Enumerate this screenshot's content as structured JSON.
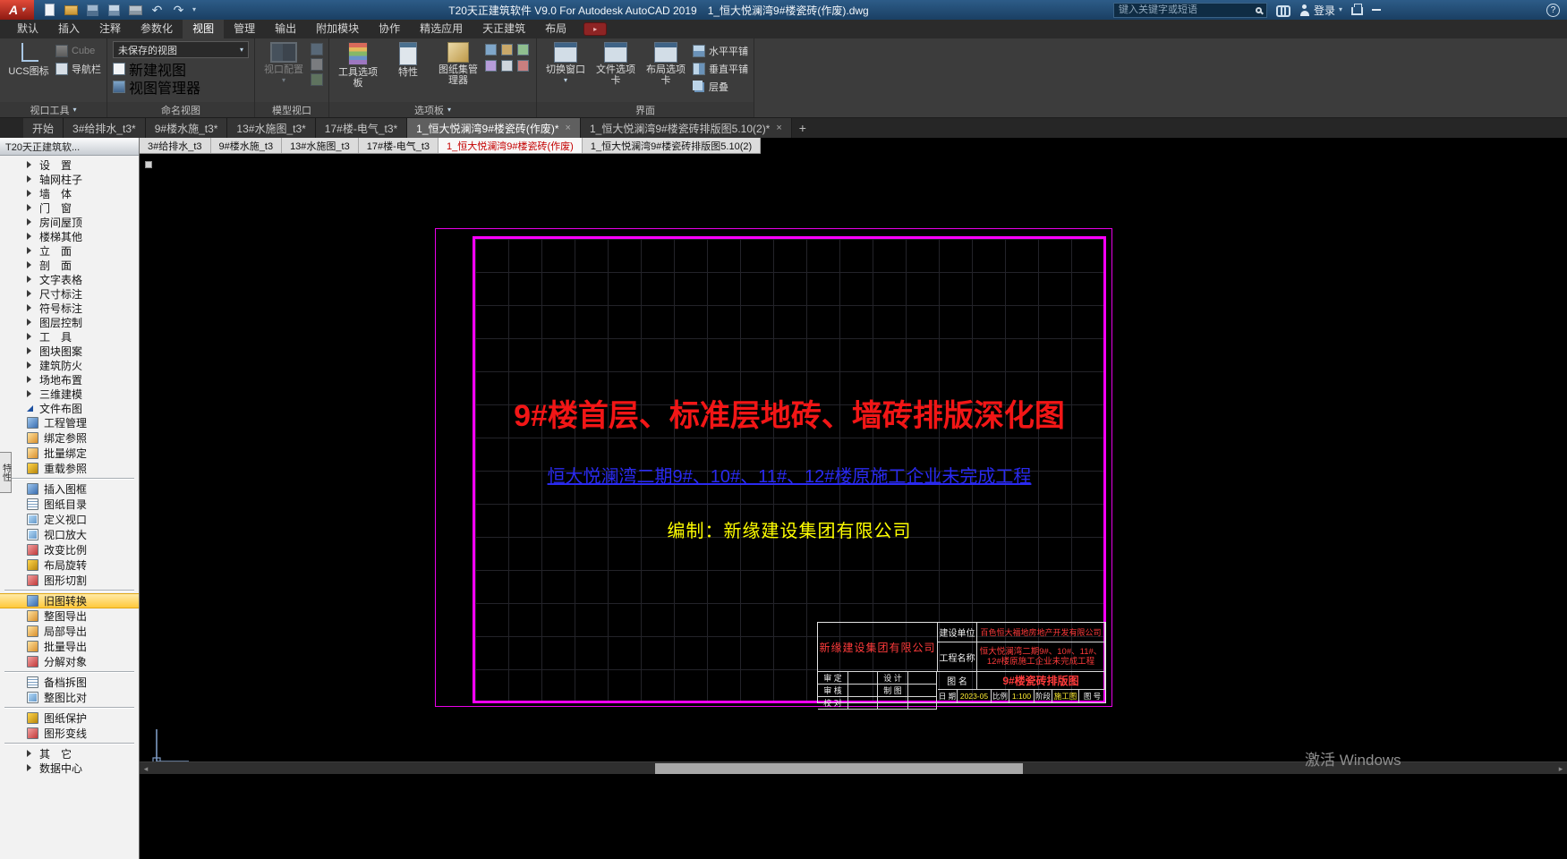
{
  "titlebar": {
    "title": "T20天正建筑软件 V9.0 For Autodesk AutoCAD 2019　1_恒大悦澜湾9#楼瓷砖(作废).dwg",
    "search_placeholder": "键入关键字或短语",
    "login_label": "登录"
  },
  "ribbon": {
    "tabs": [
      "默认",
      "插入",
      "注释",
      "参数化",
      "视图",
      "管理",
      "输出",
      "附加模块",
      "协作",
      "精选应用",
      "天正建筑",
      "布局"
    ],
    "active_tab": "视图",
    "panels": {
      "viewport_tools": {
        "label": "视口工具",
        "ucs_icon": "UCS图标",
        "viewcube": "Cube",
        "navbar": "导航栏"
      },
      "named_views": {
        "label": "命名视图",
        "combo_value": "未保存的视图",
        "new_view": "新建视图",
        "view_manager": "视图管理器"
      },
      "model_viewports": {
        "label": "模型视口",
        "viewport_config": "视口配置"
      },
      "palettes": {
        "label": "选项板",
        "tool_palettes": "工具选项板",
        "properties": "特性",
        "sheet_set": "图纸集管理器"
      },
      "interface": {
        "label": "界面",
        "switch_windows": "切换窗口",
        "file_tabs": "文件选项卡",
        "layout_tabs": "布局选项卡",
        "tile_h": "水平平铺",
        "tile_v": "垂直平铺",
        "cascade": "层叠"
      }
    }
  },
  "file_tabs": {
    "tabs": [
      "开始",
      "3#给排水_t3*",
      "9#楼水施_t3*",
      "13#水施图_t3*",
      "17#楼-电气_t3*",
      "1_恒大悦澜湾9#楼瓷砖(作废)*",
      "1_恒大悦澜湾9#楼瓷砖排版图5.10(2)*"
    ],
    "active_index": 5
  },
  "t20_tabs": {
    "tabs": [
      "3#给排水_t3",
      "9#楼水施_t3",
      "13#水施图_t3",
      "17#楼-电气_t3",
      "1_恒大悦澜湾9#楼瓷砖(作废)",
      "1_恒大悦澜湾9#楼瓷砖排版图5.10(2)"
    ],
    "active_index": 4
  },
  "sidebar": {
    "title": "T20天正建筑软...",
    "properties_tab": "特性",
    "groups": [
      "设　置",
      "轴网柱子",
      "墙　体",
      "门　窗",
      "房间屋顶",
      "楼梯其他",
      "立　面",
      "剖　面",
      "文字表格",
      "尺寸标注",
      "符号标注",
      "图层控制",
      "工　具",
      "图块图案",
      "建筑防火",
      "场地布置",
      "三维建模",
      "文件布图"
    ],
    "items": [
      {
        "label": "工程管理",
        "icon": "project-manager-icon"
      },
      {
        "label": "绑定参照",
        "icon": "bind-xref-icon"
      },
      {
        "label": "批量绑定",
        "icon": "batch-bind-icon"
      },
      {
        "label": "重载参照",
        "icon": "reload-xref-icon"
      },
      {
        "label": "插入图框",
        "icon": "insert-frame-icon"
      },
      {
        "label": "图纸目录",
        "icon": "sheet-catalog-icon"
      },
      {
        "label": "定义视口",
        "icon": "define-viewport-icon"
      },
      {
        "label": "视口放大",
        "icon": "viewport-zoom-icon"
      },
      {
        "label": "改变比例",
        "icon": "change-scale-icon"
      },
      {
        "label": "布局旋转",
        "icon": "layout-rotate-icon"
      },
      {
        "label": "图形切割",
        "icon": "drawing-cut-icon"
      },
      {
        "label": "旧图转换",
        "icon": "old-drawing-convert-icon"
      },
      {
        "label": "整图导出",
        "icon": "export-whole-icon"
      },
      {
        "label": "局部导出",
        "icon": "export-partial-icon"
      },
      {
        "label": "批量导出",
        "icon": "batch-export-icon"
      },
      {
        "label": "分解对象",
        "icon": "explode-object-icon"
      },
      {
        "label": "备档拆图",
        "icon": "archive-split-icon"
      },
      {
        "label": "整图比对",
        "icon": "drawing-compare-icon"
      },
      {
        "label": "图纸保护",
        "icon": "drawing-protect-icon"
      },
      {
        "label": "图形变线",
        "icon": "drawing-to-line-icon"
      }
    ],
    "more": [
      "其　它",
      "数据中心"
    ],
    "highlighted_item": "旧图转换"
  },
  "drawing": {
    "main_title": "9#楼首层、标准层地砖、墙砖排版深化图",
    "subtitle": "恒大悦澜湾二期9#、10#、11#、12#楼原施工企业未完成工程",
    "compiler": "编制：新缘建设集团有限公司",
    "titleblock": {
      "company": "新缘建设集团有限公司",
      "build_unit_label": "建设单位",
      "build_unit_value": "百色恒大福地房地产开发有限公司",
      "project_label": "工程名称",
      "project_value": "恒大悦澜湾二期9#、10#、11#、12#楼原施工企业未完成工程",
      "approver_label": "审 定",
      "designer_label": "设 计",
      "checker_label": "审 核",
      "drafter_label": "制 图",
      "proof_label": "校 对",
      "title_label": "图 名",
      "title_value": "9#楼瓷砖排版图",
      "date_label": "日 期",
      "date_value": "2023-05",
      "scale_label": "比例",
      "scale_value": "1:100",
      "stage_label": "阶段",
      "stage_value": "施工图",
      "no_label": "图 号"
    }
  },
  "watermark": "激活 Windows",
  "colors": {
    "sheet_border_magenta": "#FF00FF",
    "title_red": "#F21616",
    "subtitle_blue": "#2A2AF0",
    "text_yellow": "#FFFF00",
    "highlight_yellow": "#FFC93C"
  }
}
